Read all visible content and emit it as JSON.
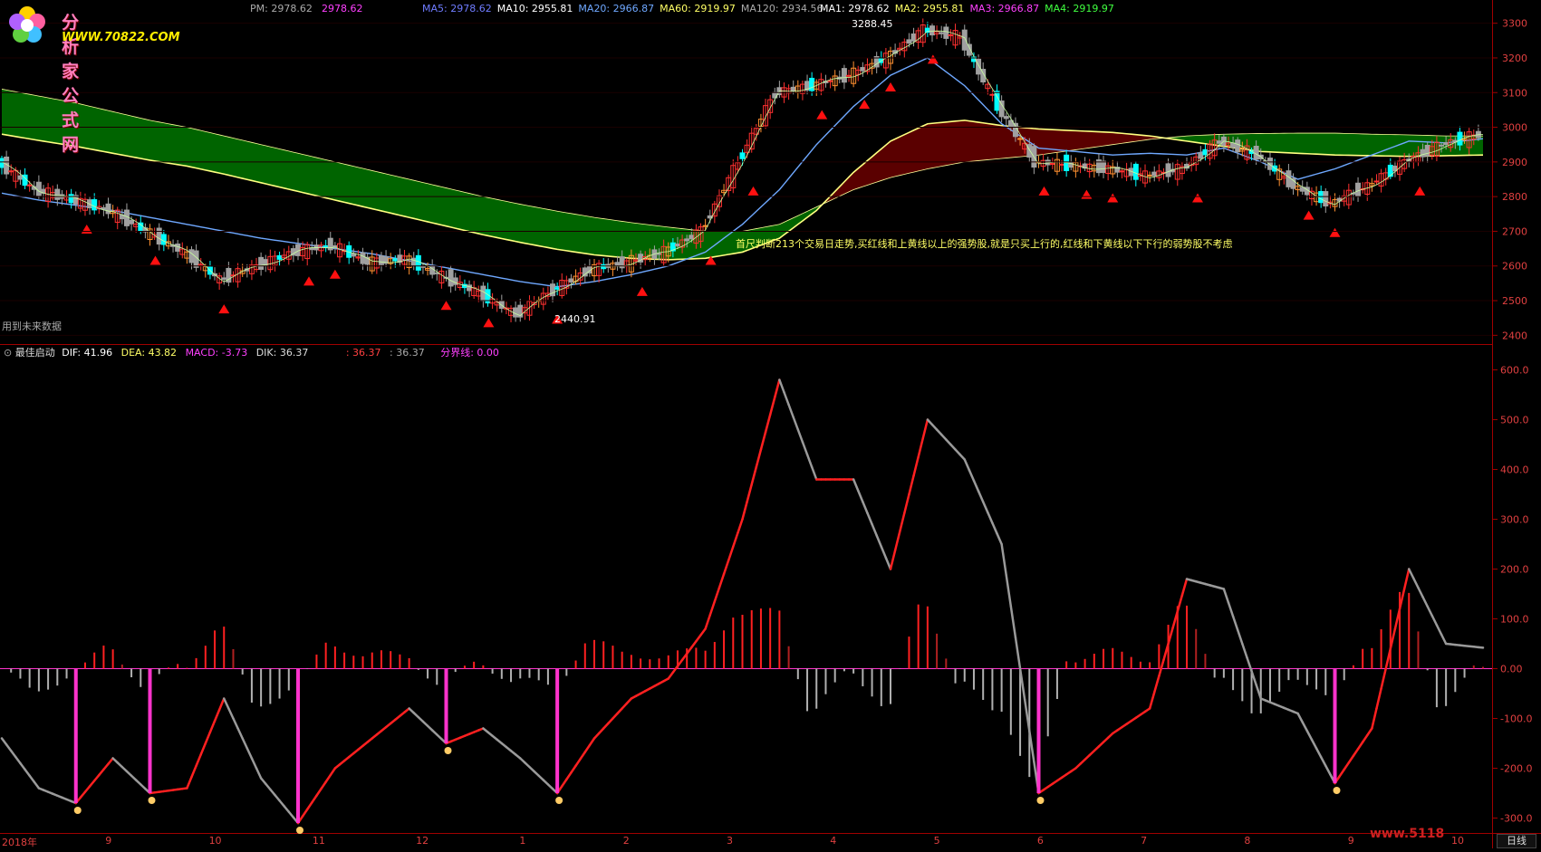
{
  "logo": {
    "title": "分析家公式网",
    "url": "WWW.70822.COM"
  },
  "main_header": {
    "pm_label": "PM: 2978.62",
    "pm_value": "2978.62",
    "ma_items": [
      {
        "text": "MA5: 2978.62",
        "color": "#6f7cff"
      },
      {
        "text": "MA10: 2955.81",
        "color": "#ffffff"
      },
      {
        "text": "MA20: 2966.87",
        "color": "#6fa8ff"
      },
      {
        "text": "MA60: 2919.97",
        "color": "#ffff66"
      },
      {
        "text": "MA120: 2934.56",
        "color": "#aaaaaa"
      }
    ],
    "ma2_items": [
      {
        "text": "MA1: 2978.62",
        "color": "#ffffff"
      },
      {
        "text": "MA2: 2955.81",
        "color": "#ffff66"
      },
      {
        "text": "MA3: 2966.87",
        "color": "#ff40ff"
      },
      {
        "text": "MA4: 2919.97",
        "color": "#40ff40"
      }
    ]
  },
  "annotation": "首尺判断213个交易日走势,买红线和上黄线以上的强势股,就是只买上行的,红线和下黄线以下下行的弱势股不考虑",
  "peak_label": "3288.45",
  "trough_label": "2440.91",
  "future_note": "用到未来数据",
  "indicator_header": {
    "name": "最佳启动",
    "dif": "DIF: 41.96",
    "dea": "DEA: 43.82",
    "macd": "MACD: -3.73",
    "dik": "DIK: 36.37",
    "v1": ": 36.37",
    "v2": ": 36.37",
    "boundary": "分界线: 0.00"
  },
  "price_axis": [
    "3300",
    "3200",
    "3100",
    "3000",
    "2900",
    "2800",
    "2700",
    "2600",
    "2500",
    "2400"
  ],
  "ind_axis": [
    "600.0",
    "500.0",
    "400.0",
    "300.0",
    "200.0",
    "100.0",
    "0.00",
    "-100.0",
    "-200.0",
    "-300.0"
  ],
  "date_labels": [
    "2018年",
    "9",
    "10",
    "11",
    "12",
    "1",
    "2",
    "3",
    "4",
    "5",
    "6",
    "7",
    "8",
    "9",
    "10"
  ],
  "button_day": "日线",
  "watermark": "www.5118",
  "colors": {
    "up": "#ff3030",
    "down": "#00ffff",
    "green_band": "#006400",
    "red_band": "#5a0000",
    "yellow": "#ffff80",
    "blue": "#6fa8ff",
    "macd_red": "#ff2020",
    "macd_gray": "#9a9a9a",
    "magenta": "#ff33cc"
  },
  "chart_data": [
    {
      "type": "line",
      "title": "",
      "ylim": [
        2380,
        3320
      ],
      "x": [
        0,
        1,
        2,
        3,
        4,
        5,
        6,
        7,
        8,
        9,
        10,
        11,
        12,
        13,
        14,
        15,
        16,
        17,
        18,
        19,
        20,
        21,
        22,
        23,
        24,
        25,
        26,
        27,
        28,
        29,
        30,
        31,
        32,
        33,
        34,
        35,
        36,
        37,
        38,
        39,
        40
      ],
      "series": [
        {
          "name": "MA60",
          "values": [
            2980,
            2962,
            2945,
            2925,
            2905,
            2888,
            2865,
            2840,
            2815,
            2790,
            2765,
            2740,
            2715,
            2690,
            2668,
            2648,
            2632,
            2622,
            2618,
            2622,
            2640,
            2680,
            2760,
            2870,
            2960,
            3010,
            3020,
            3005,
            2995,
            2990,
            2985,
            2975,
            2960,
            2945,
            2930,
            2925,
            2920,
            2918,
            2916,
            2918,
            2920
          ]
        },
        {
          "name": "MA120",
          "values": [
            3110,
            3090,
            3070,
            3045,
            3020,
            3000,
            2975,
            2950,
            2925,
            2900,
            2875,
            2850,
            2825,
            2800,
            2778,
            2758,
            2740,
            2725,
            2712,
            2700,
            2700,
            2720,
            2770,
            2820,
            2855,
            2880,
            2900,
            2910,
            2920,
            2935,
            2950,
            2965,
            2975,
            2980,
            2982,
            2983,
            2983,
            2980,
            2978,
            2975,
            2975
          ]
        },
        {
          "name": "MA20",
          "values": [
            2810,
            2790,
            2775,
            2760,
            2740,
            2720,
            2700,
            2680,
            2665,
            2650,
            2635,
            2615,
            2595,
            2575,
            2555,
            2540,
            2555,
            2575,
            2600,
            2640,
            2720,
            2820,
            2950,
            3060,
            3150,
            3200,
            3120,
            3010,
            2940,
            2930,
            2920,
            2925,
            2920,
            2940,
            2900,
            2850,
            2880,
            2920,
            2960,
            2955,
            2967
          ]
        },
        {
          "name": "Close",
          "values": [
            2900,
            2820,
            2790,
            2760,
            2700,
            2640,
            2560,
            2600,
            2640,
            2660,
            2610,
            2620,
            2570,
            2520,
            2460,
            2530,
            2590,
            2610,
            2640,
            2700,
            2900,
            3100,
            3120,
            3150,
            3200,
            3280,
            3260,
            3060,
            2900,
            2890,
            2880,
            2860,
            2880,
            2960,
            2920,
            2830,
            2780,
            2830,
            2900,
            2950,
            2978
          ]
        }
      ]
    },
    {
      "type": "line",
      "title": "",
      "ylim": [
        -330,
        630
      ],
      "x": [
        0,
        1,
        2,
        3,
        4,
        5,
        6,
        7,
        8,
        9,
        10,
        11,
        12,
        13,
        14,
        15,
        16,
        17,
        18,
        19,
        20,
        21,
        22,
        23,
        24,
        25,
        26,
        27,
        28,
        29,
        30,
        31,
        32,
        33,
        34,
        35,
        36,
        37,
        38,
        39,
        40
      ],
      "series": [
        {
          "name": "DIF",
          "values": [
            -140,
            -240,
            -270,
            -180,
            -250,
            -240,
            -60,
            -220,
            -310,
            -200,
            -140,
            -80,
            -150,
            -120,
            -180,
            -250,
            -140,
            -60,
            -20,
            80,
            300,
            580,
            380,
            380,
            200,
            500,
            420,
            250,
            -250,
            -200,
            -130,
            -80,
            180,
            160,
            -60,
            -90,
            -230,
            -120,
            200,
            50,
            42
          ]
        }
      ]
    }
  ]
}
